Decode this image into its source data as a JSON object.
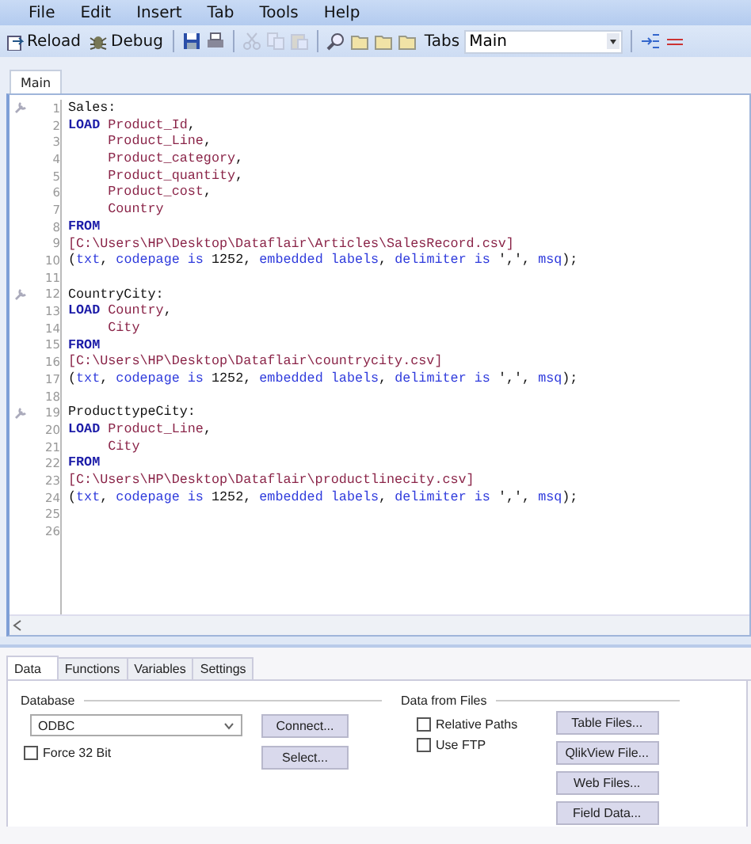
{
  "menu": [
    "File",
    "Edit",
    "Insert",
    "Tab",
    "Tools",
    "Help"
  ],
  "toolbar": [
    {
      "kind": "reload",
      "label": "Reload",
      "disabled": false
    },
    {
      "kind": "debug",
      "label": "Debug",
      "disabled": false
    },
    {
      "kind": "save",
      "disabled": false
    },
    {
      "kind": "print",
      "disabled": false
    },
    {
      "kind": "cut",
      "disabled": true
    },
    {
      "kind": "copy",
      "disabled": true
    },
    {
      "kind": "paste",
      "disabled": true
    },
    {
      "kind": "find",
      "disabled": false
    },
    {
      "kind": "folder",
      "disabled": false
    },
    {
      "kind": "folder",
      "disabled": false
    },
    {
      "kind": "folder",
      "disabled": false
    }
  ],
  "tabs_label": "Tabs",
  "tab_select": "Main",
  "toolbar_end": [
    {
      "kind": "add-tab"
    },
    {
      "kind": "remove-tab"
    }
  ],
  "script_tabs": [
    {
      "label": "Main",
      "selected": true
    }
  ],
  "lines": [
    {
      "number": "1",
      "bookmark": true,
      "indented": false,
      "segments": [
        {
          "kind": "label",
          "text": "Sales:"
        }
      ]
    },
    {
      "number": "2",
      "bookmark": false,
      "indented": false,
      "segments": [
        {
          "kind": "keyword",
          "text": "LOAD "
        },
        {
          "kind": "field",
          "text": "Product_Id"
        },
        {
          "kind": "plain",
          "text": ","
        }
      ]
    },
    {
      "number": "3",
      "bookmark": false,
      "indented": true,
      "segments": [
        {
          "kind": "field",
          "text": "Product_Line"
        },
        {
          "kind": "plain",
          "text": ","
        }
      ]
    },
    {
      "number": "4",
      "bookmark": false,
      "indented": true,
      "segments": [
        {
          "kind": "field",
          "text": "Product_category"
        },
        {
          "kind": "plain",
          "text": ","
        }
      ]
    },
    {
      "number": "5",
      "bookmark": false,
      "indented": true,
      "segments": [
        {
          "kind": "field",
          "text": "Product_quantity"
        },
        {
          "kind": "plain",
          "text": ","
        }
      ]
    },
    {
      "number": "6",
      "bookmark": false,
      "indented": true,
      "segments": [
        {
          "kind": "field",
          "text": "Product_cost"
        },
        {
          "kind": "plain",
          "text": ","
        }
      ]
    },
    {
      "number": "7",
      "bookmark": false,
      "indented": true,
      "segments": [
        {
          "kind": "field",
          "text": "Country"
        }
      ]
    },
    {
      "number": "8",
      "bookmark": false,
      "indented": false,
      "segments": [
        {
          "kind": "keyword",
          "text": "FROM"
        }
      ]
    },
    {
      "number": "9",
      "bookmark": false,
      "indented": false,
      "segments": [
        {
          "kind": "path",
          "text": "[C:\\Users\\HP\\Desktop\\Dataflair\\Articles\\SalesRecord.csv]"
        }
      ]
    },
    {
      "number": "10",
      "bookmark": false,
      "indented": false,
      "segments": [
        {
          "kind": "plain",
          "text": "("
        },
        {
          "kind": "option",
          "text": "txt"
        },
        {
          "kind": "plain",
          "text": ", "
        },
        {
          "kind": "option",
          "text": "codepage is"
        },
        {
          "kind": "plain",
          "text": " 1252, "
        },
        {
          "kind": "option",
          "text": "embedded labels"
        },
        {
          "kind": "plain",
          "text": ", "
        },
        {
          "kind": "option",
          "text": "delimiter is"
        },
        {
          "kind": "plain",
          "text": " ',', "
        },
        {
          "kind": "option",
          "text": "msq"
        },
        {
          "kind": "plain",
          "text": ");"
        }
      ]
    },
    {
      "number": "11",
      "bookmark": false,
      "indented": false
    },
    {
      "number": "12",
      "bookmark": true,
      "indented": false,
      "segments": [
        {
          "kind": "label",
          "text": "CountryCity:"
        }
      ]
    },
    {
      "number": "13",
      "bookmark": false,
      "indented": false,
      "segments": [
        {
          "kind": "keyword",
          "text": "LOAD "
        },
        {
          "kind": "field",
          "text": "Country"
        },
        {
          "kind": "plain",
          "text": ","
        }
      ]
    },
    {
      "number": "14",
      "bookmark": false,
      "indented": true,
      "segments": [
        {
          "kind": "field",
          "text": "City"
        }
      ]
    },
    {
      "number": "15",
      "bookmark": false,
      "indented": false,
      "segments": [
        {
          "kind": "keyword",
          "text": "FROM"
        }
      ]
    },
    {
      "number": "16",
      "bookmark": false,
      "indented": false,
      "segments": [
        {
          "kind": "path",
          "text": "[C:\\Users\\HP\\Desktop\\Dataflair\\countrycity.csv]"
        }
      ]
    },
    {
      "number": "17",
      "bookmark": false,
      "indented": false,
      "segments": [
        {
          "kind": "plain",
          "text": "("
        },
        {
          "kind": "option",
          "text": "txt"
        },
        {
          "kind": "plain",
          "text": ", "
        },
        {
          "kind": "option",
          "text": "codepage is"
        },
        {
          "kind": "plain",
          "text": " 1252, "
        },
        {
          "kind": "option",
          "text": "embedded labels"
        },
        {
          "kind": "plain",
          "text": ", "
        },
        {
          "kind": "option",
          "text": "delimiter is"
        },
        {
          "kind": "plain",
          "text": " ',', "
        },
        {
          "kind": "option",
          "text": "msq"
        },
        {
          "kind": "plain",
          "text": ");"
        }
      ]
    },
    {
      "number": "18",
      "bookmark": false,
      "indented": false
    },
    {
      "number": "19",
      "bookmark": true,
      "indented": false,
      "segments": [
        {
          "kind": "label",
          "text": "ProducttypeCity:"
        }
      ]
    },
    {
      "number": "20",
      "bookmark": false,
      "indented": false,
      "segments": [
        {
          "kind": "keyword",
          "text": "LOAD "
        },
        {
          "kind": "field",
          "text": "Product_Line"
        },
        {
          "kind": "plain",
          "text": ","
        }
      ]
    },
    {
      "number": "21",
      "bookmark": false,
      "indented": true,
      "segments": [
        {
          "kind": "field",
          "text": "City"
        }
      ]
    },
    {
      "number": "22",
      "bookmark": false,
      "indented": false,
      "segments": [
        {
          "kind": "keyword",
          "text": "FROM"
        }
      ]
    },
    {
      "number": "23",
      "bookmark": false,
      "indented": false,
      "segments": [
        {
          "kind": "path",
          "text": "[C:\\Users\\HP\\Desktop\\Dataflair\\productlinecity.csv]"
        }
      ]
    },
    {
      "number": "24",
      "bookmark": false,
      "indented": false,
      "segments": [
        {
          "kind": "plain",
          "text": "("
        },
        {
          "kind": "option",
          "text": "txt"
        },
        {
          "kind": "plain",
          "text": ", "
        },
        {
          "kind": "option",
          "text": "codepage is"
        },
        {
          "kind": "plain",
          "text": " 1252, "
        },
        {
          "kind": "option",
          "text": "embedded labels"
        },
        {
          "kind": "plain",
          "text": ", "
        },
        {
          "kind": "option",
          "text": "delimiter is"
        },
        {
          "kind": "plain",
          "text": " ',', "
        },
        {
          "kind": "option",
          "text": "msq"
        },
        {
          "kind": "plain",
          "text": ");"
        }
      ]
    },
    {
      "number": "25",
      "bookmark": false,
      "indented": false
    },
    {
      "number": "26",
      "bookmark": false,
      "indented": false
    }
  ],
  "panel_tabs": [
    {
      "label": "Data",
      "selected": true
    },
    {
      "label": "Functions",
      "selected": false
    },
    {
      "label": "Variables",
      "selected": false
    },
    {
      "label": "Settings",
      "selected": false
    }
  ],
  "database": {
    "legend": "Database",
    "select": "ODBC",
    "checkbox": {
      "label": "Force 32 Bit",
      "checked": false
    },
    "buttons": [
      "Connect...",
      "Select..."
    ]
  },
  "files": {
    "legend": "Data from Files",
    "checkboxes": [
      {
        "label": "Relative Paths",
        "checked": false
      },
      {
        "label": "Use FTP",
        "checked": false
      }
    ],
    "buttons": [
      "Table Files...",
      "QlikView File...",
      "Web Files...",
      "Field Data..."
    ]
  }
}
